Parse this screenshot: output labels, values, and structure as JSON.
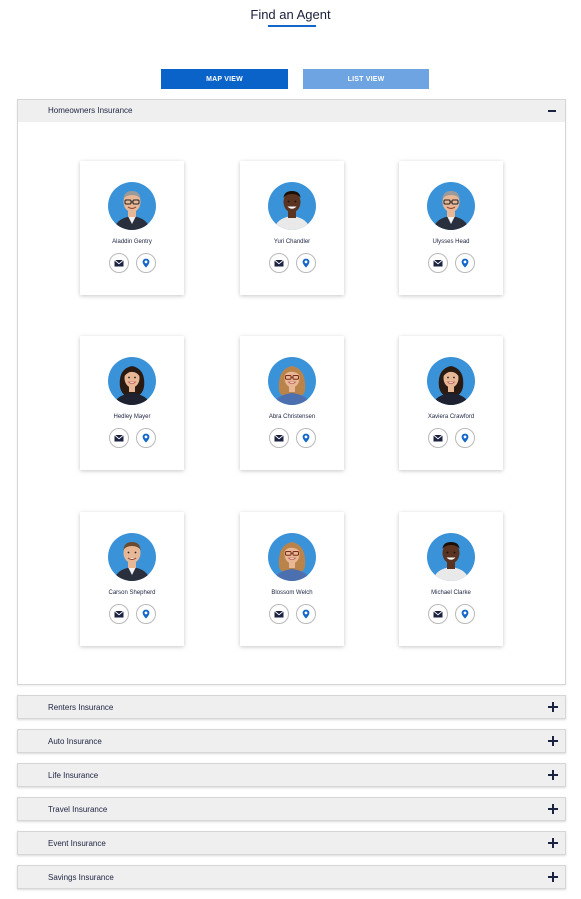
{
  "header": {
    "title": "Find an Agent"
  },
  "view_toggle": {
    "map_label": "MAP VIEW",
    "list_label": "LIST VIEW"
  },
  "colors": {
    "accent": "#0a63c9",
    "accent_light": "#6ea4e2",
    "avatar_bg": "#3a93d8",
    "text": "#1c2340"
  },
  "sections": [
    {
      "label": "Homeowners Insurance",
      "expanded": true
    },
    {
      "label": "Renters Insurance",
      "expanded": false
    },
    {
      "label": "Auto Insurance",
      "expanded": false
    },
    {
      "label": "Life Insurance",
      "expanded": false
    },
    {
      "label": "Travel Insurance",
      "expanded": false
    },
    {
      "label": "Event Insurance",
      "expanded": false
    },
    {
      "label": "Savings Insurance",
      "expanded": false
    }
  ],
  "agents": [
    {
      "name": "Aladdin Gentry",
      "avatar": "man-glasses"
    },
    {
      "name": "Yuri Chandler",
      "avatar": "man-dark"
    },
    {
      "name": "Ulysses Head",
      "avatar": "man-glasses"
    },
    {
      "name": "Hedley Mayer",
      "avatar": "woman-dark-hair"
    },
    {
      "name": "Abra Christensen",
      "avatar": "woman-glasses"
    },
    {
      "name": "Xaviera Crawford",
      "avatar": "woman-dark-hair"
    },
    {
      "name": "Carson Shepherd",
      "avatar": "man-smiling"
    },
    {
      "name": "Blossom Welch",
      "avatar": "woman-glasses"
    },
    {
      "name": "Michael Clarke",
      "avatar": "man-dark"
    }
  ],
  "icons": {
    "email": "envelope-icon",
    "location": "map-pin-icon",
    "collapse": "minus-icon",
    "expand": "plus-icon"
  }
}
